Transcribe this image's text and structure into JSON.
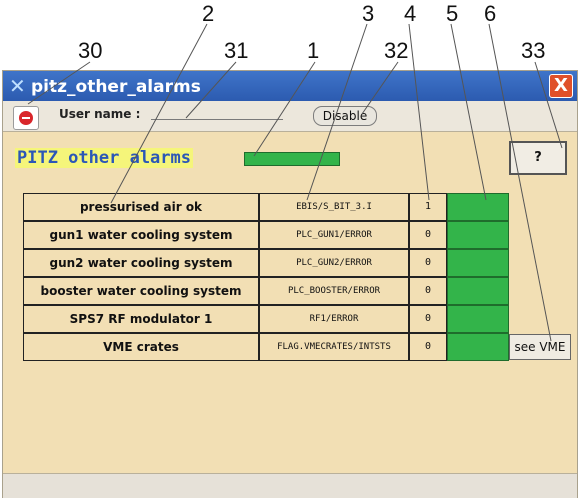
{
  "callouts": [
    "30",
    "31",
    "1",
    "32",
    "2",
    "3",
    "4",
    "5",
    "6",
    "33"
  ],
  "window": {
    "title": "pitz_other_alarms",
    "close_glyph": "X",
    "title_icon": "x-logo-icon"
  },
  "userbar": {
    "user_label": "User name :",
    "user_value": "",
    "disable_label": "Disable",
    "stop_icon": "stop-icon"
  },
  "panel": {
    "title": "PITZ other alarms",
    "help_label": "?",
    "summary_status_color": "#33b44a"
  },
  "alarms": [
    {
      "name": "pressurised air ok",
      "address": "EBIS/S_BIT_3.I",
      "value": "1",
      "led_color": "#33b44a"
    },
    {
      "name": "gun1 water cooling system",
      "address": "PLC_GUN1/ERROR",
      "value": "0",
      "led_color": "#33b44a"
    },
    {
      "name": "gun2 water cooling system",
      "address": "PLC_GUN2/ERROR",
      "value": "0",
      "led_color": "#33b44a"
    },
    {
      "name": "booster water cooling system",
      "address": "PLC_BOOSTER/ERROR",
      "value": "0",
      "led_color": "#33b44a"
    },
    {
      "name": "SPS7 RF modulator 1",
      "address": "RF1/ERROR",
      "value": "0",
      "led_color": "#33b44a"
    },
    {
      "name": "VME crates",
      "address": "FLAG.VMECRATES/INTSTS",
      "value": "0",
      "led_color": "#33b44a",
      "button": "see VME"
    }
  ],
  "colors": {
    "window_bg": "#f2dfb4",
    "titlebar": "#2c5bb0",
    "title_highlight": "#f5f57a",
    "title_text": "#2b57b7",
    "ok_green": "#33b44a"
  }
}
